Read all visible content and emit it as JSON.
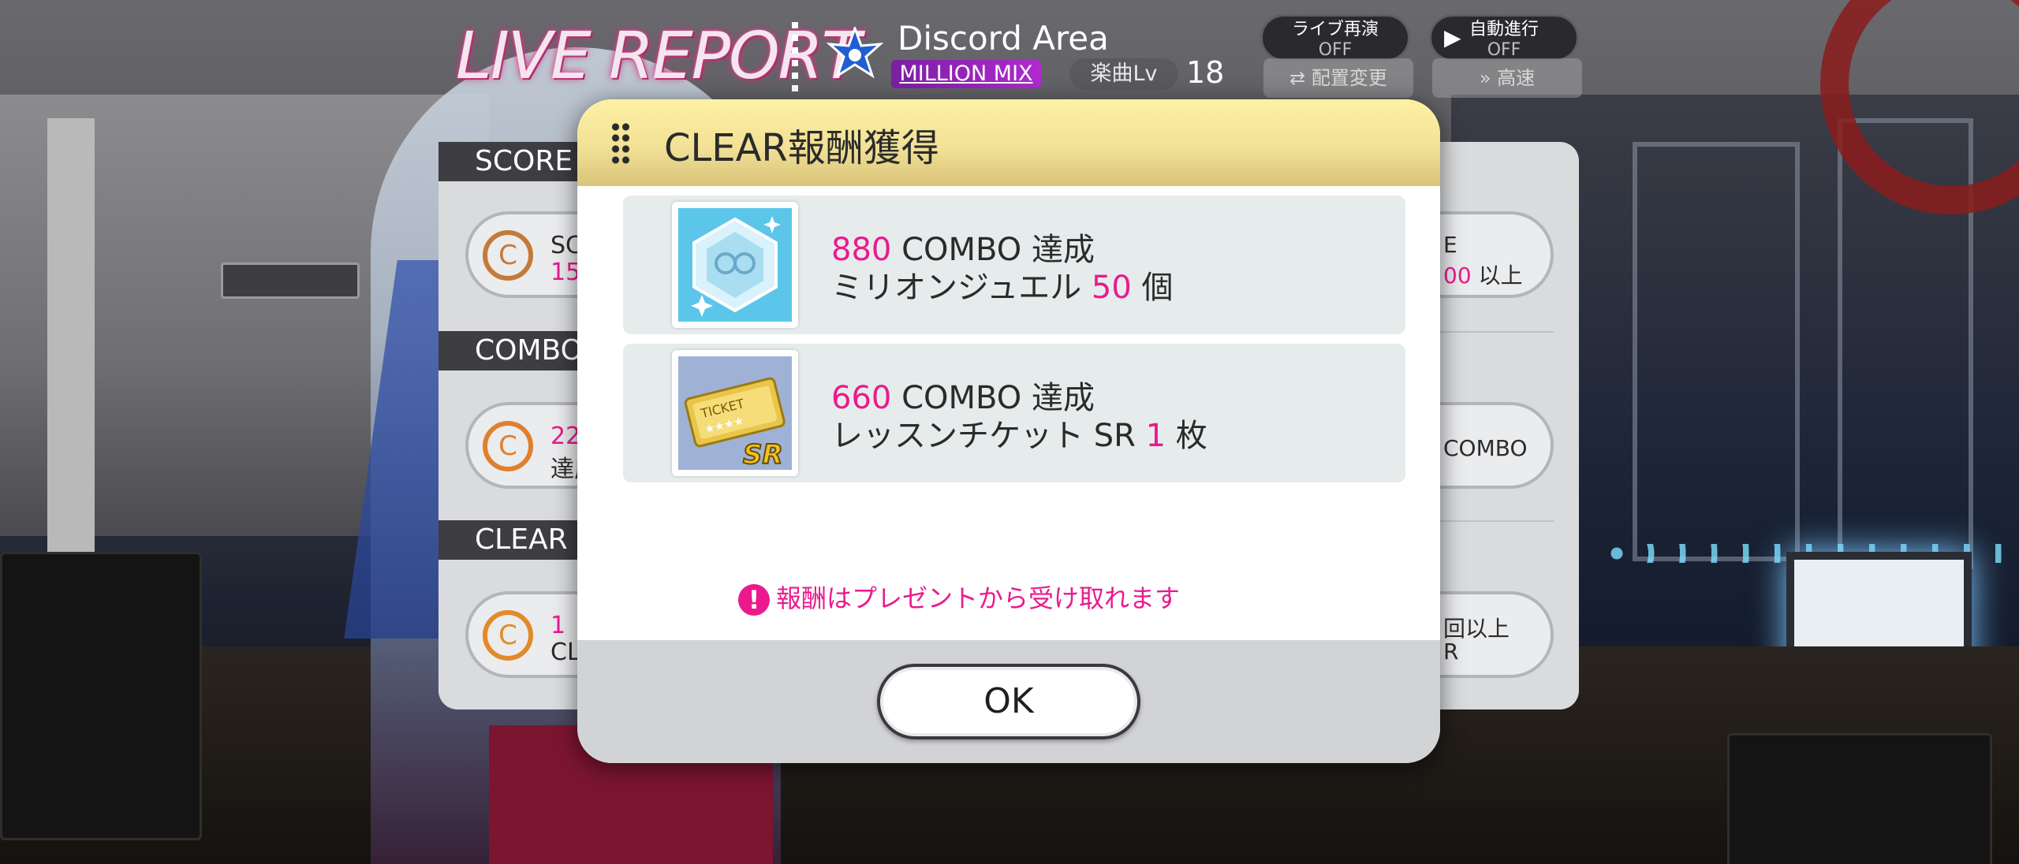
{
  "header": {
    "report_title": "LIVE REPORT",
    "song_title": "Discord Area",
    "mix_label": "MILLION MIX",
    "level_label": "楽曲Lv",
    "level_value": "18",
    "replay_label": "ライブ再演",
    "replay_state": "OFF",
    "auto_label": "自動進行",
    "auto_state": "OFF",
    "arrange_label": "配置変更",
    "speed_label": "高速"
  },
  "sections": {
    "score": "SCORE",
    "combo": "COMBO",
    "clear": "CLEAR"
  },
  "left_pills": {
    "score_t1": "SC",
    "score_t2": "15",
    "combo_t1": "22",
    "combo_t2": "達成",
    "clear_t1": "1",
    "clear_t2": "CL"
  },
  "right_pills": {
    "score_t1": "E",
    "score_t2a": "00",
    "score_t2b": "以上",
    "combo_t1": "COMBO",
    "clear_t1": "回以上",
    "clear_t2": "R"
  },
  "modal": {
    "title": "CLEAR報酬獲得",
    "rewards": [
      {
        "combo_num": "880",
        "combo_text": "COMBO 達成",
        "item_name": "ミリオンジュエル",
        "item_qty": "50",
        "item_unit": "個",
        "icon": "million-jewel-icon"
      },
      {
        "combo_num": "660",
        "combo_text": "COMBO 達成",
        "item_name": "レッスンチケット SR",
        "item_qty": "1",
        "item_unit": "枚",
        "icon": "lesson-ticket-sr-icon"
      }
    ],
    "notice": "報酬はプレゼントから受け取れます",
    "ok_label": "OK"
  },
  "colors": {
    "accent_pink": "#ea1a8e",
    "header_gold": "#f2e196",
    "mix_purple": "#9b27c0"
  }
}
